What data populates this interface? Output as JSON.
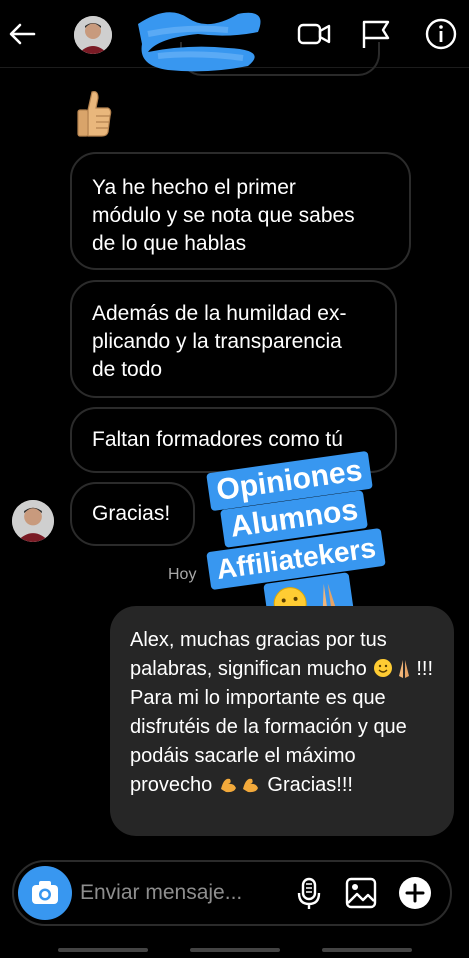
{
  "header": {
    "icons": [
      "back-arrow-icon",
      "video-camera-icon",
      "flag-icon",
      "info-icon"
    ]
  },
  "messages": {
    "m1": "Ya he hecho el primer\nmódulo y se nota que sabes\nde lo que hablas",
    "m2": "Además de la humildad ex-\nplicando y la transparencia\nde todo",
    "m3": "Faltan formadores como tú",
    "m4": "Gracias!",
    "timestamp": "Hoy",
    "reply_part1": "Alex, muchas gracias por tus palabras, significan mucho ",
    "reply_part2": "!!! Para mi lo importante es que disfrutéis de la formación y que podáis sacarle el máximo provecho ",
    "reply_part3": " Gracias!!!"
  },
  "sticker": {
    "line1": "Opiniones",
    "line2": "Alumnos",
    "line3": "Affiliatekers"
  },
  "composer": {
    "placeholder": "Enviar mensaje..."
  },
  "colors": {
    "accent": "#3897f0",
    "my_bubble": "#262626",
    "bubble_border": "#2b2b2b"
  }
}
